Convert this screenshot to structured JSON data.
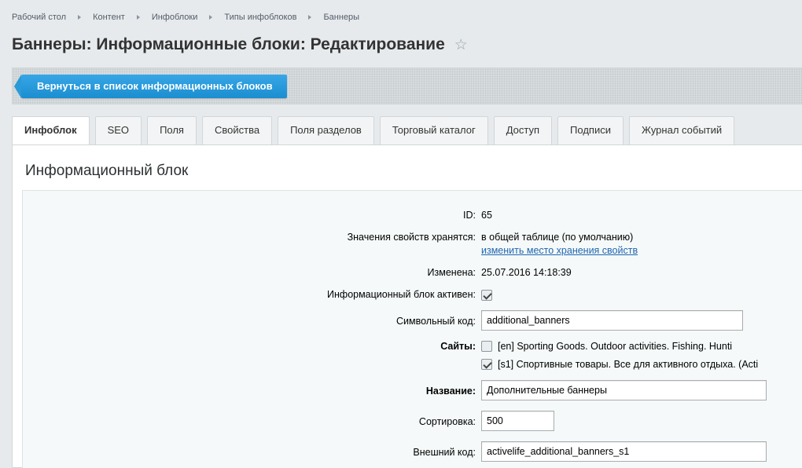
{
  "breadcrumb": [
    "Рабочий стол",
    "Контент",
    "Инфоблоки",
    "Типы инфоблоков",
    "Баннеры"
  ],
  "page_title": "Баннеры: Информационные блоки: Редактирование",
  "back_button": "Вернуться в список информационных блоков",
  "tabs": [
    "Инфоблок",
    "SEO",
    "Поля",
    "Свойства",
    "Поля разделов",
    "Торговый каталог",
    "Доступ",
    "Подписи",
    "Журнал событий"
  ],
  "section_title": "Информационный блок",
  "form": {
    "id_label": "ID:",
    "id_value": "65",
    "storage_label": "Значения свойств хранятся:",
    "storage_value": "в общей таблице (по умолчанию)",
    "storage_link": "изменить место хранения свойств",
    "modified_label": "Изменена:",
    "modified_value": "25.07.2016 14:18:39",
    "active_label": "Информационный блок активен:",
    "active_checked": true,
    "code_label": "Символьный код:",
    "code_value": "additional_banners",
    "sites_label": "Сайты:",
    "sites": [
      {
        "text": "[en] Sporting Goods. Outdoor activities. Fishing. Hunti",
        "checked": false
      },
      {
        "text": "[s1] Спортивные товары. Все для активного отдыха. (Acti",
        "checked": true
      }
    ],
    "name_label": "Название:",
    "name_value": "Дополнительные баннеры",
    "sort_label": "Сортировка:",
    "sort_value": "500",
    "external_label": "Внешний код:",
    "external_value": "activelife_additional_banners_s1"
  }
}
